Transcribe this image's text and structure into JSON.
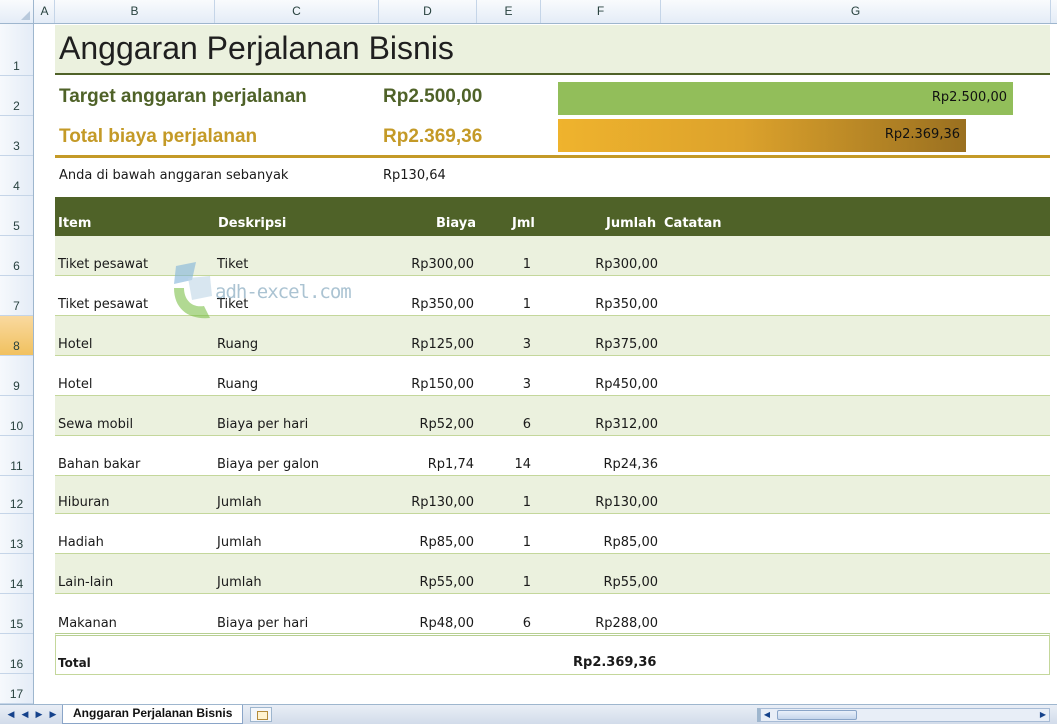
{
  "columns": [
    "A",
    "B",
    "C",
    "D",
    "E",
    "F",
    "G"
  ],
  "rows": [
    "1",
    "2",
    "3",
    "4",
    "5",
    "6",
    "7",
    "8",
    "9",
    "10",
    "11",
    "12",
    "13",
    "14",
    "15",
    "16",
    "17"
  ],
  "selected_row": "8",
  "title": "Anggaran Perjalanan Bisnis",
  "summary": {
    "target_label": "Target anggaran perjalanan",
    "target_value": "Rp2.500,00",
    "total_label": "Total biaya perjalanan",
    "total_value": "Rp2.369,36",
    "under_label": "Anda di bawah anggaran sebanyak",
    "under_value": "Rp130,64"
  },
  "bars": {
    "target_label": "Rp2.500,00",
    "total_label": "Rp2.369,36",
    "target_amount": 2500.0,
    "total_amount": 2369.36,
    "target_color": "#92be5a",
    "total_color": "#efb32d"
  },
  "table": {
    "headers": [
      "Item",
      "Deskripsi",
      "Biaya",
      "Jml",
      "Jumlah",
      "Catatan"
    ],
    "rows": [
      {
        "item": "Tiket pesawat",
        "desc": "Tiket",
        "cost": "Rp300,00",
        "qty": "1",
        "amount": "Rp300,00"
      },
      {
        "item": "Tiket pesawat",
        "desc": "Tiket",
        "cost": "Rp350,00",
        "qty": "1",
        "amount": "Rp350,00"
      },
      {
        "item": "Hotel",
        "desc": "Ruang",
        "cost": "Rp125,00",
        "qty": "3",
        "amount": "Rp375,00"
      },
      {
        "item": "Hotel",
        "desc": "Ruang",
        "cost": "Rp150,00",
        "qty": "3",
        "amount": "Rp450,00"
      },
      {
        "item": "Sewa mobil",
        "desc": "Biaya per hari",
        "cost": "Rp52,00",
        "qty": "6",
        "amount": "Rp312,00"
      },
      {
        "item": "Bahan bakar",
        "desc": "Biaya per galon",
        "cost": "Rp1,74",
        "qty": "14",
        "amount": "Rp24,36"
      },
      {
        "item": "Hiburan",
        "desc": "Jumlah",
        "cost": "Rp130,00",
        "qty": "1",
        "amount": "Rp130,00"
      },
      {
        "item": "Hadiah",
        "desc": "Jumlah",
        "cost": "Rp85,00",
        "qty": "1",
        "amount": "Rp85,00"
      },
      {
        "item": "Lain-lain",
        "desc": "Jumlah",
        "cost": "Rp55,00",
        "qty": "1",
        "amount": "Rp55,00"
      },
      {
        "item": "Makanan",
        "desc": "Biaya per hari",
        "cost": "Rp48,00",
        "qty": "6",
        "amount": "Rp288,00"
      }
    ],
    "total_label": "Total",
    "total_amount": "Rp2.369,36"
  },
  "watermark": "adh-excel.com",
  "sheet_tab": "Anggaran Perjalanan Bisnis",
  "colors": {
    "header_green": "#4f6228",
    "band_green": "#ebf1de",
    "gold": "#c49a27"
  }
}
